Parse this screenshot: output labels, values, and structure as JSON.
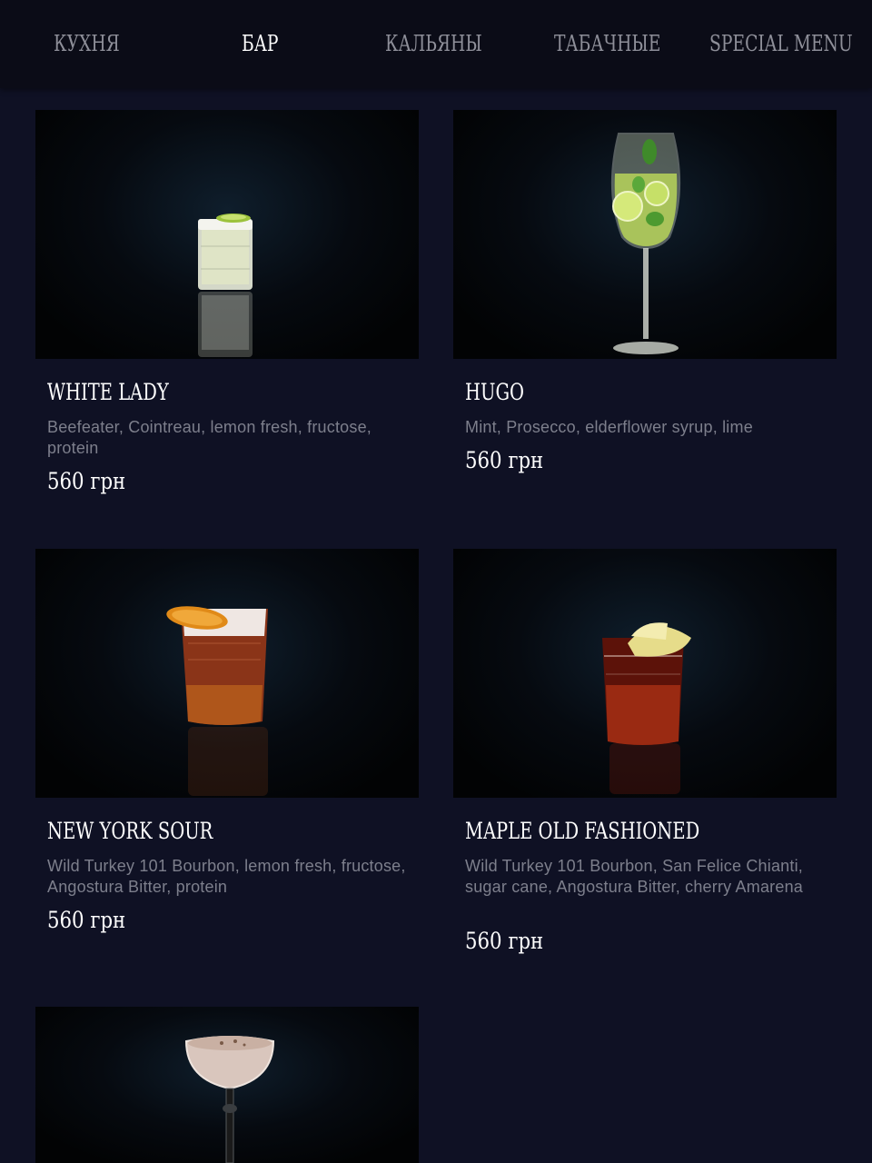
{
  "nav": {
    "tabs": [
      {
        "label": "КУХНЯ",
        "active": false
      },
      {
        "label": "БАР",
        "active": true
      },
      {
        "label": "КАЛЬЯНЫ",
        "active": false
      },
      {
        "label": "ТАБАЧНЫЕ",
        "active": false
      },
      {
        "label": "SPECIAL MENU",
        "active": false
      }
    ]
  },
  "menu": {
    "items": [
      {
        "name": "WHITE LADY",
        "description": "Beefeater, Cointreau, lemon fresh, fructose, protein",
        "price": "560 грн",
        "image": "highball-glass-lime-garnish"
      },
      {
        "name": "HUGO",
        "description": "Mint, Prosecco, elderflower syrup, lime",
        "price": "560 грн",
        "image": "wine-glass-lime-mint"
      },
      {
        "name": "NEW YORK SOUR",
        "description": "Wild Turkey 101 Bourbon, lemon fresh, fructose, Angostura Bitter, protein",
        "price": "560 грн",
        "image": "rocks-glass-dried-orange"
      },
      {
        "name": "MAPLE OLD FASHIONED",
        "description": "Wild Turkey 101 Bourbon, San Felice Chianti, sugar cane, Angostura Bitter, cherry Amarena",
        "price": "560 грн",
        "image": "rocks-glass-apple-slices"
      },
      {
        "name": "",
        "description": "",
        "price": "",
        "image": "coupe-glass-creamy-cocktail"
      }
    ]
  },
  "colors": {
    "background": "#0f1124",
    "nav_background": "#0b0c17",
    "tab_inactive": "#8e8f99",
    "tab_active": "#ffffff",
    "description": "#7d7f8c"
  }
}
